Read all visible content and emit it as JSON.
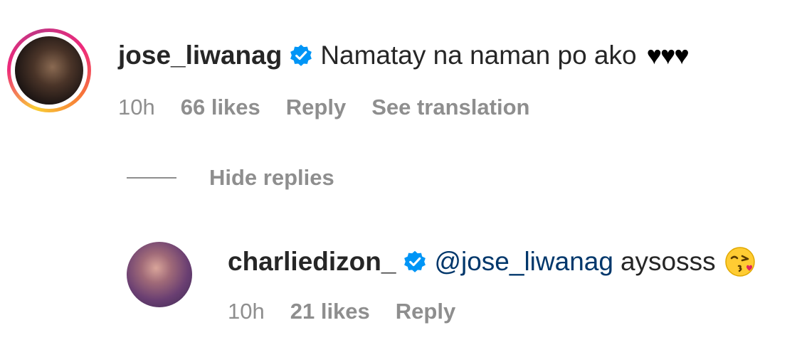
{
  "comment": {
    "username": "jose_liwanag",
    "text": "Namatay na naman po ako",
    "hearts": "♥♥♥",
    "time": "10h",
    "likes": "66 likes",
    "reply": "Reply",
    "see_translation": "See translation"
  },
  "replies_toggle": {
    "label": "Hide replies"
  },
  "reply_comment": {
    "username": "charliedizon_",
    "mention": "@jose_liwanag",
    "text": "aysosss",
    "emoji": "face-blowing-kiss-emoji",
    "time": "10h",
    "likes": "21 likes",
    "reply": "Reply"
  },
  "colors": {
    "verified": "#0095f6",
    "mention": "#00376b",
    "meta": "#8e8e8e",
    "text": "#262626"
  }
}
